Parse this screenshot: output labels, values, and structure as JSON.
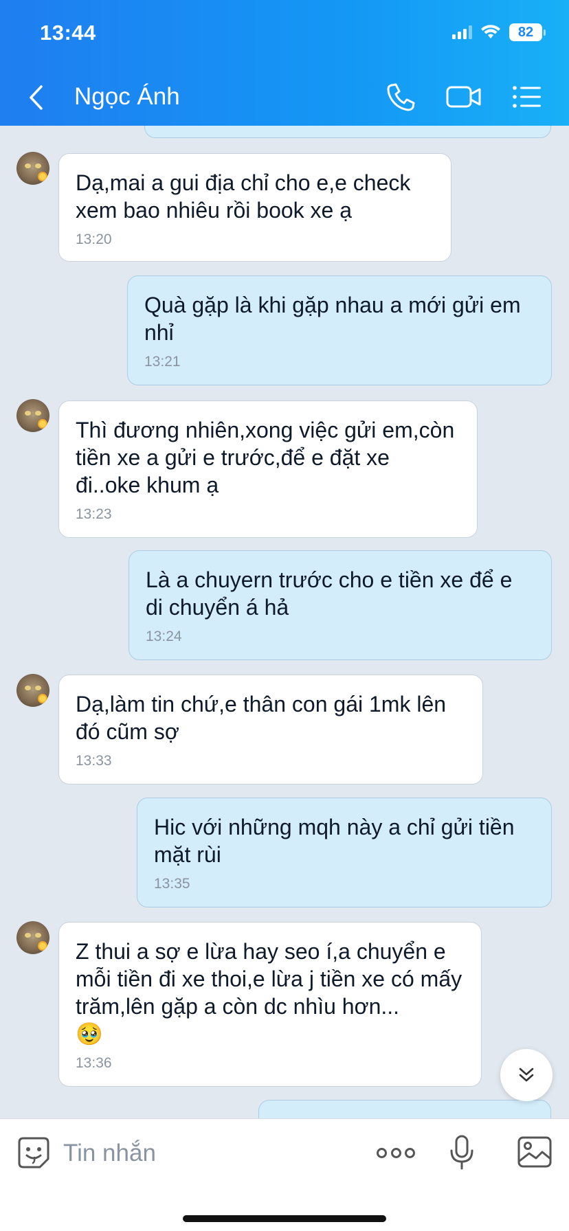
{
  "status_bar": {
    "time": "13:44",
    "battery": "82"
  },
  "header": {
    "contact_name": "Ngọc Ánh"
  },
  "messages": [
    {
      "text": "Dạ,mai a gui địa chỉ cho e,e check xem bao nhiêu rồi book xe ạ",
      "time": "13:20"
    },
    {
      "text": "Quà gặp là khi gặp nhau a mới gửi em nhỉ",
      "time": "13:21"
    },
    {
      "text": "Thì đương nhiên,xong việc gửi em,còn tiền xe a gửi e trước,để e đặt xe đi..oke khum ạ",
      "time": "13:23"
    },
    {
      "text": "Là a chuyern trước cho e tiền xe để e di chuyển á hả",
      "time": "13:24"
    },
    {
      "text": "Dạ,làm tin chứ,e thân con gái 1mk lên đó cũm sợ",
      "time": "13:33"
    },
    {
      "text": "Hic với những mqh này a chỉ gửi tiền mặt rùi",
      "time": "13:35"
    },
    {
      "text": "Z thui a sợ e lừa hay seo í,a chuyển e mỗi tiền đi xe thoi,e lừa j tiền xe có mấy trăm,lên gặp a còn dc nhìu hơn...",
      "emoji": "🥹",
      "time": "13:36"
    }
  ],
  "input": {
    "placeholder": "Tin nhắn"
  },
  "colors": {
    "header_start": "#1f7ef0",
    "header_end": "#19b0f7",
    "outgoing_bubble": "#d3edfb",
    "incoming_bubble": "#ffffff",
    "chat_bg": "#e2e8f0"
  },
  "icons": [
    "back-icon",
    "phone-icon",
    "video-call-icon",
    "menu-list-icon",
    "emoji-sticker-icon",
    "more-dots-icon",
    "microphone-icon",
    "image-icon",
    "scroll-down-icon"
  ]
}
